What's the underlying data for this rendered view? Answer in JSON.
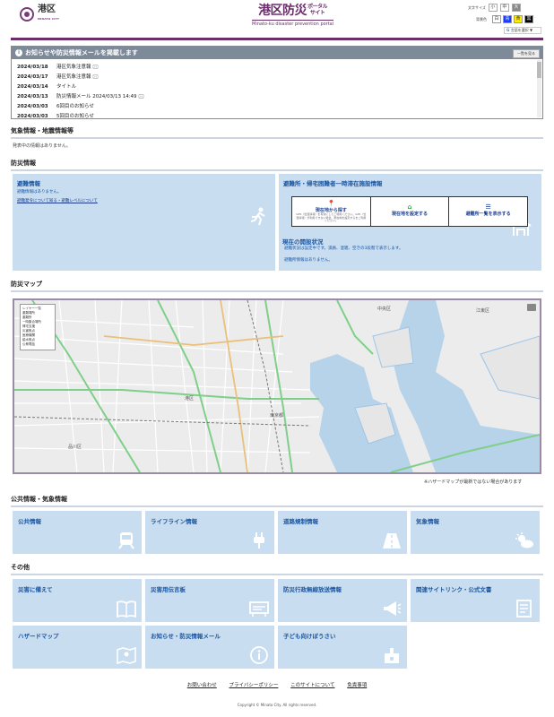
{
  "header": {
    "logo_text": "港区",
    "logo_sub": "MINATO CITY",
    "brand_main": "港区防災",
    "brand_portal": "ポータル\nサイト",
    "brand_en": "Minato-ku disaster prevention portal",
    "fontsize_label": "文字サイズ",
    "fontsize_options": [
      "小",
      "中",
      "大"
    ],
    "color_label": "背景色",
    "color_options": [
      "白",
      "青",
      "黄",
      "黒"
    ],
    "translate_label": "言語を選択 ▼"
  },
  "notice": {
    "title": "お知らせや防災情報メールを掲載します",
    "all_button": "一覧を見る",
    "items": [
      {
        "date": "2024/03/18",
        "text": "港区気象注意報 🖂"
      },
      {
        "date": "2024/03/17",
        "text": "港区気象注意報 🖂"
      },
      {
        "date": "2024/03/14",
        "text": "タイトル"
      },
      {
        "date": "2024/03/13",
        "text": "防災情報メール 2024/03/13 14:49 🖂"
      },
      {
        "date": "2024/03/03",
        "text": "6回目のお知らせ"
      },
      {
        "date": "2024/03/03",
        "text": "5回目のお知らせ"
      }
    ]
  },
  "weather": {
    "title": "気象情報・地震情報等",
    "note": "発表中の情報はありません。"
  },
  "bousai": {
    "title": "防災情報",
    "evac": {
      "title": "避難情報",
      "text": "避難情報はありません。",
      "link": "避難発令について知る・避難レベルについて"
    },
    "shelter": {
      "title": "避難所・帰宅困難者一時滞在施設情報",
      "btn1": "現在地から探す",
      "btn1_note": "GPS（位置情報）を有効にしてご利用ください。GPS（位置情報）が利用できない場合、現在地を設定するをご利用ください。",
      "btn2": "現在地を設定する",
      "btn3": "避難所一覧を表示する",
      "status_title": "現在の開設状況",
      "status_text1": "避難状況は設定中です。満員、混雑、空きの3段階で表示します。",
      "status_text2": "避難所情報はありません。"
    }
  },
  "map": {
    "title": "防災マップ",
    "legend": [
      "レイヤー一覧",
      "避難場所",
      "避難所",
      "一時集合場所",
      "帰宅支援",
      "災害拠点",
      "医療機関",
      "給水拠点",
      "公衆電話"
    ],
    "labels": [
      "港区",
      "東京都",
      "江東区",
      "中央区",
      "品川区"
    ],
    "note": "※ハザードマップが最新ではない場合があります"
  },
  "public": {
    "title": "公共情報・気象情報",
    "cards": [
      "公共情報",
      "ライフライン情報",
      "道路規制情報",
      "気象情報"
    ]
  },
  "other": {
    "title": "その他",
    "cards": [
      "災害に備えて",
      "災害用伝言板",
      "防災行政無線放送情報",
      "関連サイトリンク・公式文書",
      "ハザードマップ",
      "お知らせ・防災情報メール",
      "子ども向けぼうさい"
    ]
  },
  "footer": {
    "links": [
      "お問い合わせ",
      "プライバシーポリシー",
      "このサイトについて",
      "免責事項"
    ],
    "copyright": "Copyright © Minato City. All rights reserved."
  },
  "colors": {
    "brand": "#6b2e6b",
    "panel": "#c9ddf1",
    "link": "#1a56a0"
  }
}
